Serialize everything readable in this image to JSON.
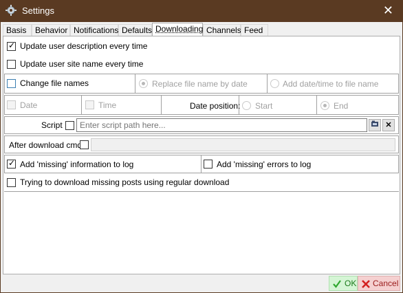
{
  "window": {
    "title": "Settings",
    "icon": "gear-icon",
    "close_label": "✕"
  },
  "tabs": [
    {
      "label": "Basis"
    },
    {
      "label": "Behavior"
    },
    {
      "label": "Notifications"
    },
    {
      "label": "Defaults"
    },
    {
      "label": "Downloading",
      "active": true
    },
    {
      "label": "Channels"
    },
    {
      "label": "Feed"
    }
  ],
  "options": {
    "update_description": {
      "label": "Update user description every time",
      "checked": true
    },
    "update_site_name": {
      "label": "Update user site name every time",
      "checked": false
    },
    "change_file_names": {
      "label": "Change file names",
      "checked": false
    },
    "replace_by_date": {
      "label": "Replace file name by date",
      "selected": true
    },
    "add_datetime": {
      "label": "Add date/time to file name",
      "selected": false
    },
    "date": {
      "label": "Date",
      "checked": false
    },
    "time": {
      "label": "Time",
      "checked": false
    },
    "date_position": {
      "label": "Date position:",
      "start_label": "Start",
      "end_label": "End",
      "selected": "End"
    },
    "script": {
      "label": "Script",
      "checked": false,
      "placeholder": "Enter script path here...",
      "value": "",
      "browse_icon": "folder-icon",
      "clear_icon": "close-icon"
    },
    "after_download_cmd": {
      "label": "After download cmd",
      "checked": false,
      "value": ""
    },
    "add_missing_info": {
      "label": "Add 'missing' information to log",
      "checked": true
    },
    "add_missing_errors": {
      "label": "Add 'missing' errors to log",
      "checked": false
    },
    "try_missing_posts": {
      "label": "Trying to download missing posts using regular download",
      "checked": false
    }
  },
  "buttons": {
    "ok": "OK",
    "cancel": "Cancel",
    "ok_icon": "checkmark-icon",
    "cancel_icon": "cross-icon"
  }
}
